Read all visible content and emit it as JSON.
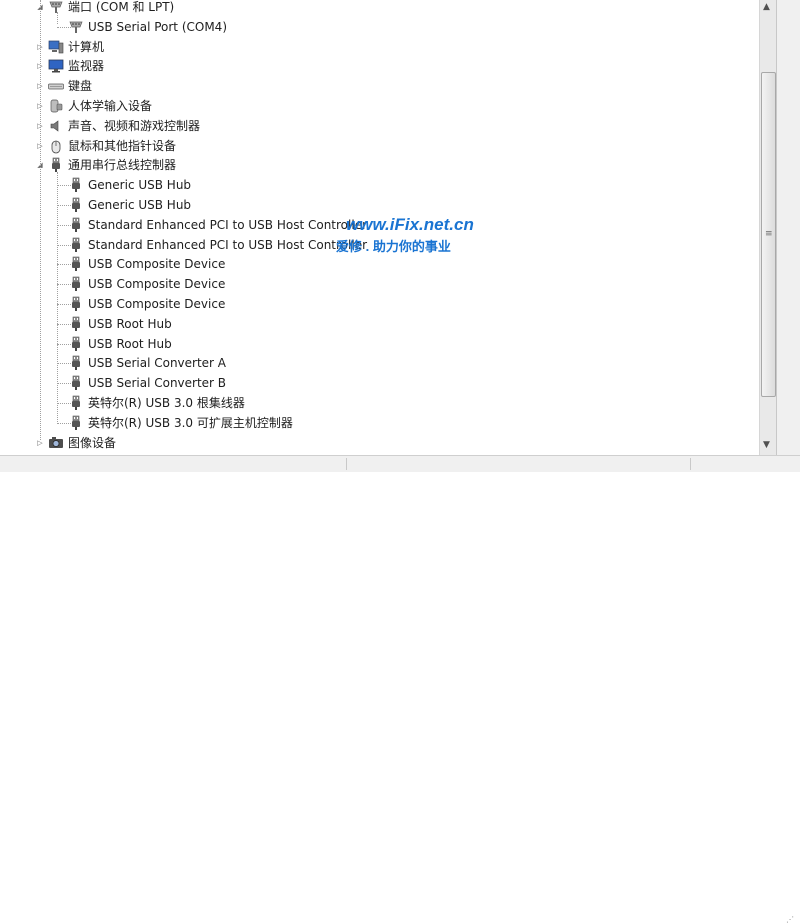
{
  "tree": {
    "rows": [
      {
        "label": "端口 (COM 和 LPT)",
        "icon": "port-icon",
        "level": 0,
        "expand": "expanded"
      },
      {
        "label": "USB Serial Port (COM4)",
        "icon": "port-icon",
        "level": 1,
        "expand": "none"
      },
      {
        "label": "计算机",
        "icon": "computer-icon",
        "level": 0,
        "expand": "collapsed"
      },
      {
        "label": "监视器",
        "icon": "monitor-icon",
        "level": 0,
        "expand": "collapsed"
      },
      {
        "label": "键盘",
        "icon": "keyboard-icon",
        "level": 0,
        "expand": "collapsed"
      },
      {
        "label": "人体学输入设备",
        "icon": "hid-icon",
        "level": 0,
        "expand": "collapsed"
      },
      {
        "label": "声音、视频和游戏控制器",
        "icon": "speaker-icon",
        "level": 0,
        "expand": "collapsed"
      },
      {
        "label": "鼠标和其他指针设备",
        "icon": "mouse-icon",
        "level": 0,
        "expand": "collapsed"
      },
      {
        "label": "通用串行总线控制器",
        "icon": "usb-plug-icon",
        "level": 0,
        "expand": "expanded"
      },
      {
        "label": "Generic USB Hub",
        "icon": "usb-plug-icon",
        "level": 1,
        "expand": "none"
      },
      {
        "label": "Generic USB Hub",
        "icon": "usb-plug-icon",
        "level": 1,
        "expand": "none"
      },
      {
        "label": "Standard Enhanced PCI to USB Host Controller",
        "icon": "usb-plug-icon",
        "level": 1,
        "expand": "none"
      },
      {
        "label": "Standard Enhanced PCI to USB Host Controller",
        "icon": "usb-plug-icon",
        "level": 1,
        "expand": "none"
      },
      {
        "label": "USB Composite Device",
        "icon": "usb-plug-icon",
        "level": 1,
        "expand": "none"
      },
      {
        "label": "USB Composite Device",
        "icon": "usb-plug-icon",
        "level": 1,
        "expand": "none"
      },
      {
        "label": "USB Composite Device",
        "icon": "usb-plug-icon",
        "level": 1,
        "expand": "none"
      },
      {
        "label": "USB Root Hub",
        "icon": "usb-plug-icon",
        "level": 1,
        "expand": "none"
      },
      {
        "label": "USB Root Hub",
        "icon": "usb-plug-icon",
        "level": 1,
        "expand": "none"
      },
      {
        "label": "USB Serial Converter A",
        "icon": "usb-plug-icon",
        "level": 1,
        "expand": "none"
      },
      {
        "label": "USB Serial Converter B",
        "icon": "usb-plug-icon",
        "level": 1,
        "expand": "none"
      },
      {
        "label": "英特尔(R) USB 3.0 根集线器",
        "icon": "usb-plug-icon",
        "level": 1,
        "expand": "none"
      },
      {
        "label": "英特尔(R) USB 3.0 可扩展主机控制器",
        "icon": "usb-plug-icon",
        "level": 1,
        "expand": "none"
      },
      {
        "label": "图像设备",
        "icon": "camera-icon",
        "level": 0,
        "expand": "collapsed"
      }
    ]
  },
  "watermark": {
    "line1": "www.iFix.net.cn",
    "line2": "爱修 . 助力你的事业",
    "color": "#1a74d2"
  },
  "colors": {
    "tree_line": "#a0a0a0",
    "text": "#1e1e1e",
    "background": "#ffffff"
  }
}
